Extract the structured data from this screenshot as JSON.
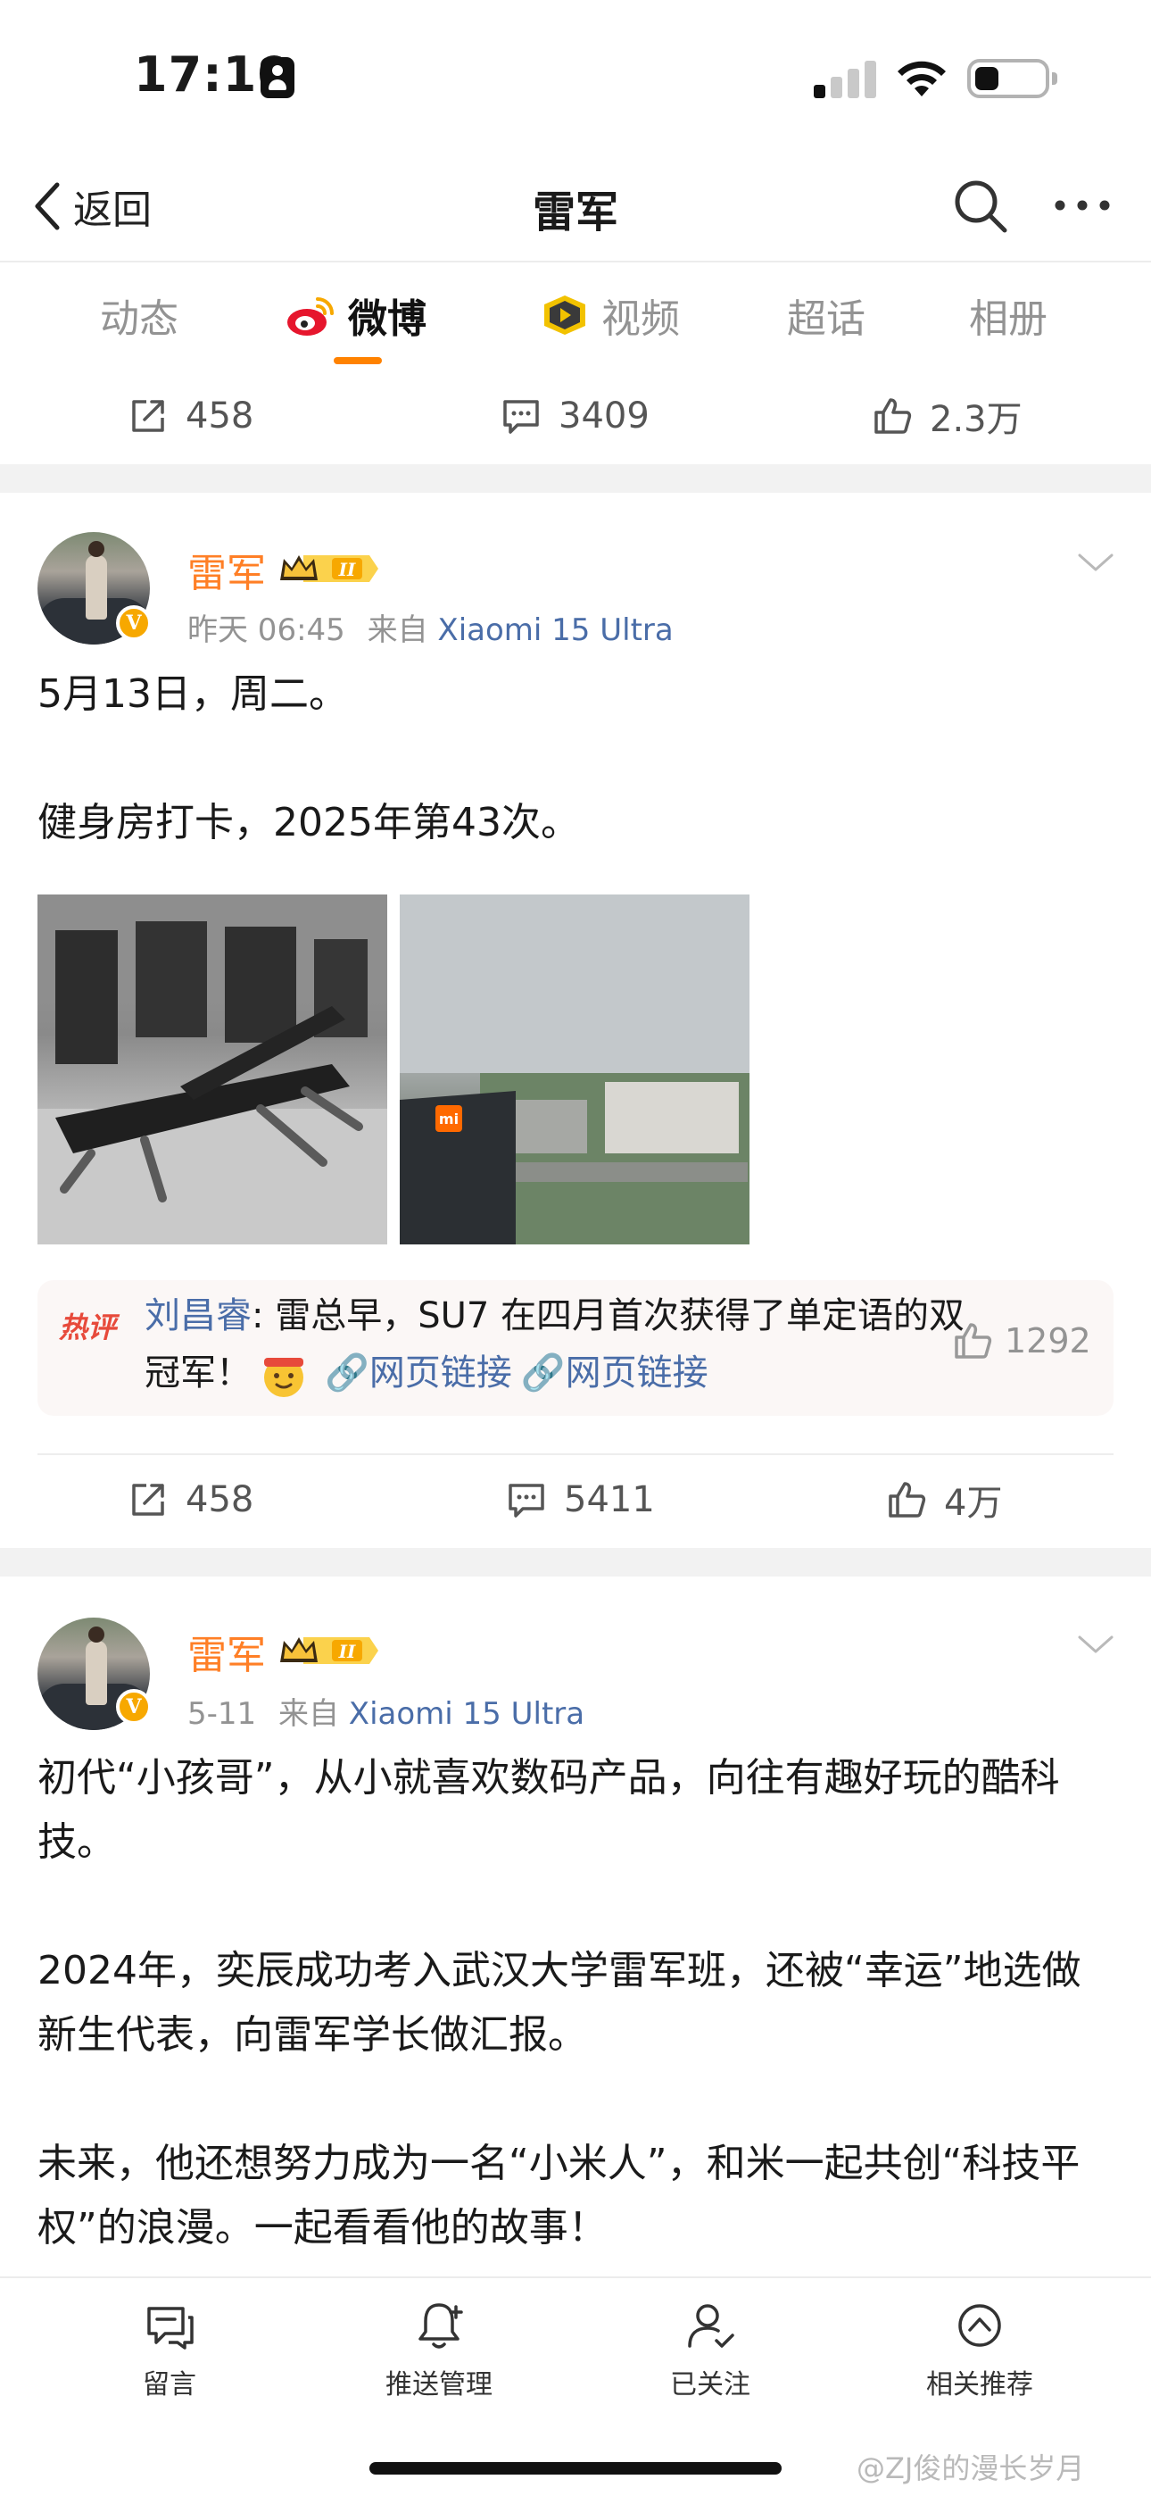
{
  "status_bar": {
    "time": "17:10"
  },
  "nav": {
    "back_label": "返回",
    "title": "雷军"
  },
  "tabs": [
    {
      "label": "动态"
    },
    {
      "label": "微博"
    },
    {
      "label": "视频"
    },
    {
      "label": "超话"
    },
    {
      "label": "相册"
    }
  ],
  "active_tab": "微博",
  "profile_stats": {
    "reposts": "458",
    "comments": "3409",
    "likes": "2.3万"
  },
  "posts": [
    {
      "user": "雷军",
      "time": "昨天 06:45",
      "source_prefix": "来自",
      "source_app": "Xiaomi 15 Ultra",
      "text": [
        "5月13日，周二。",
        "",
        "健身房打卡，2025年第43次。"
      ],
      "images": [
        "gym-photo",
        "city-view-photo"
      ],
      "hot_comment": {
        "tag": "热评",
        "author": "刘昌睿",
        "text": ": 雷总早，SU7 在四月首次获得了单定语的双冠军！",
        "links": [
          "网页链接",
          "网页链接"
        ],
        "likes": "1292"
      },
      "actions": {
        "reposts": "458",
        "comments": "5411",
        "likes": "4万"
      }
    },
    {
      "user": "雷军",
      "time": "5-11",
      "source_prefix": "来自",
      "source_app": "Xiaomi 15 Ultra",
      "text": [
        "初代“小孩哥”，从小就喜欢数码产品，向往有趣好玩的酷科技。",
        "",
        "2024年，奕辰成功考入武汉大学雷军班，还被“幸运”地选做新生代表，向雷军学长做汇报。",
        "",
        "未来，他还想努力成为一名“小米人”，和米一起共创“科技平权”的浪漫。一起看看他的故事！"
      ]
    }
  ],
  "bottom_bar": [
    {
      "label": "留言",
      "icon": "message-icon"
    },
    {
      "label": "推送管理",
      "icon": "bell-icon"
    },
    {
      "label": "已关注",
      "icon": "user-check-icon"
    },
    {
      "label": "相关推荐",
      "icon": "compass-icon"
    }
  ],
  "watermark": "@ZJ俊的漫长岁月",
  "colors": {
    "accent": "#ff8200",
    "username": "#ff7f26",
    "link": "#4a6da8",
    "hot_tag": "#e74a3b",
    "verified": "#f7a800"
  }
}
